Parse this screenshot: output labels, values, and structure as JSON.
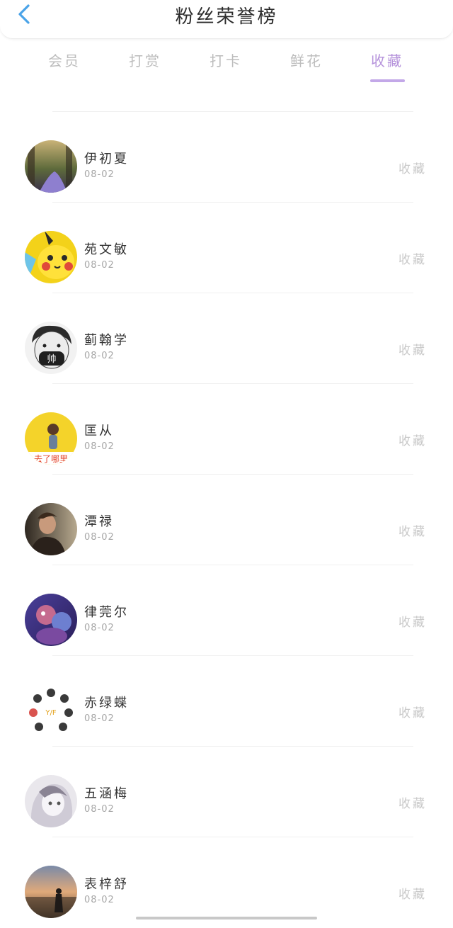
{
  "header": {
    "title": "粉丝荣誉榜"
  },
  "tabs": [
    {
      "label": "会员",
      "active": false
    },
    {
      "label": "打赏",
      "active": false
    },
    {
      "label": "打卡",
      "active": false
    },
    {
      "label": "鲜花",
      "active": false
    },
    {
      "label": "收藏",
      "active": true
    }
  ],
  "colors": {
    "accent": "#b592db",
    "back_icon": "#4aa3e8"
  },
  "fans": [
    {
      "name": "伊初夏",
      "date": "08-02",
      "tag": "收藏",
      "avatar": "forest-path-photo"
    },
    {
      "name": "苑文敏",
      "date": "08-02",
      "tag": "收藏",
      "avatar": "pikachu-cartoon"
    },
    {
      "name": "蓟翰学",
      "date": "08-02",
      "tag": "收藏",
      "avatar": "boy-mask-drawing"
    },
    {
      "name": "匡从",
      "date": "08-02",
      "tag": "收藏",
      "avatar": "girl-yellow-background"
    },
    {
      "name": "潭禄",
      "date": "08-02",
      "tag": "收藏",
      "avatar": "man-portrait"
    },
    {
      "name": "律莞尔",
      "date": "08-02",
      "tag": "收藏",
      "avatar": "purple-cartoon-character"
    },
    {
      "name": "赤绿蝶",
      "date": "08-02",
      "tag": "收藏",
      "avatar": "cartoon-group-circle"
    },
    {
      "name": "五涵梅",
      "date": "08-02",
      "tag": "收藏",
      "avatar": "anime-girl-sketch"
    },
    {
      "name": "表梓舒",
      "date": "08-02",
      "tag": "收藏",
      "avatar": "sunset-silhouette"
    }
  ]
}
